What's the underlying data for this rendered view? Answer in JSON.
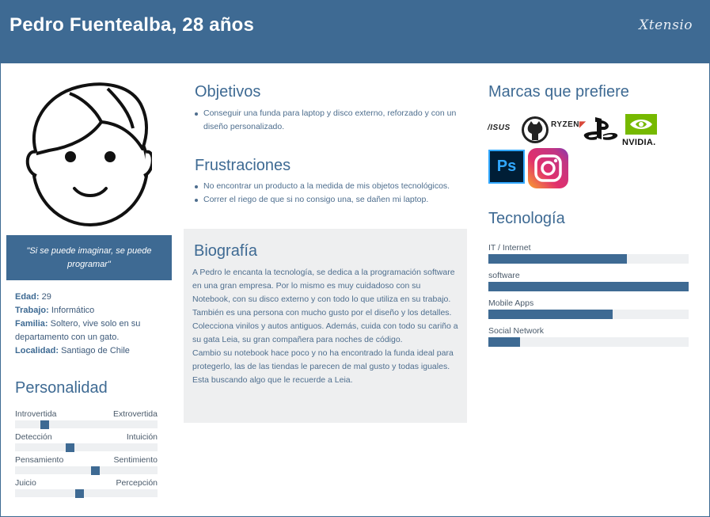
{
  "header": {
    "title": "Pedro Fuentealba, 28 años",
    "brand": "Xtensio"
  },
  "quote": "\"Si se puede imaginar, se puede programar\"",
  "info": [
    {
      "key": "Edad:",
      "value": " 29"
    },
    {
      "key": "Trabajo:",
      "value": " Informático"
    },
    {
      "key": "Familia:",
      "value": " Soltero, vive solo en su departamento con un gato."
    },
    {
      "key": "Localidad:",
      "value": " Santiago de Chile"
    }
  ],
  "personality": {
    "title": "Personalidad",
    "traits": [
      {
        "left": "Introvertida",
        "right": "Extrovertida",
        "value": 0.19
      },
      {
        "left": "Detección",
        "right": "Intuición",
        "value": 0.38
      },
      {
        "left": "Pensamiento",
        "right": "Sentimiento",
        "value": 0.57
      },
      {
        "left": "Juicio",
        "right": "Percepción",
        "value": 0.45
      }
    ]
  },
  "objectives": {
    "title": "Objetivos",
    "items": [
      "Conseguir una funda para laptop y disco externo, reforzado y con un diseño personalizado."
    ]
  },
  "frustrations": {
    "title": "Frustraciones",
    "items": [
      "No encontrar un producto a la medida de mis objetos tecnológicos.",
      "Correr el riego de que si no consigo una, se dañen mi laptop."
    ]
  },
  "bio": {
    "title": "Biografía",
    "paragraphs": [
      "A Pedro le encanta la tecnología, se dedica a la programación software en una gran empresa. Por lo mismo es muy cuidadoso con su Notebook, con su disco externo y con todo lo que utiliza en su trabajo.",
      "También es una persona con mucho gusto por el diseño y los detalles. Colecciona vinilos y autos antiguos. Además, cuida con todo su cariño a su gata Leia, su gran compañera para noches de código.",
      "Cambio su notebook hace poco y no ha encontrado la funda ideal para protegerlo, las de las tiendas le parecen de mal gusto y todas iguales. Esta buscando algo que le recuerde a Leia."
    ]
  },
  "brands": {
    "title": "Marcas que prefiere",
    "logos": [
      {
        "icon": "asus-logo",
        "text": "/ISUS"
      },
      {
        "icon": "github-logo",
        "text": ""
      },
      {
        "icon": "ryzen-logo",
        "text": "RYZEN"
      },
      {
        "icon": "playstation-logo",
        "text": ""
      },
      {
        "icon": "nvidia-logo",
        "text": "NVIDIA."
      },
      {
        "icon": "photoshop-logo",
        "text": "Ps"
      },
      {
        "icon": "instagram-logo",
        "text": ""
      }
    ]
  },
  "technology": {
    "title": "Tecnología",
    "items": [
      {
        "label": "IT / Internet",
        "value": 0.69
      },
      {
        "label": "software",
        "value": 1.0
      },
      {
        "label": "Mobile Apps",
        "value": 0.62
      },
      {
        "label": "Social Network",
        "value": 0.16
      }
    ]
  },
  "colors": {
    "accent": "#3e6a93",
    "track": "#eef0f2",
    "bio_bg": "#eeeff0"
  }
}
